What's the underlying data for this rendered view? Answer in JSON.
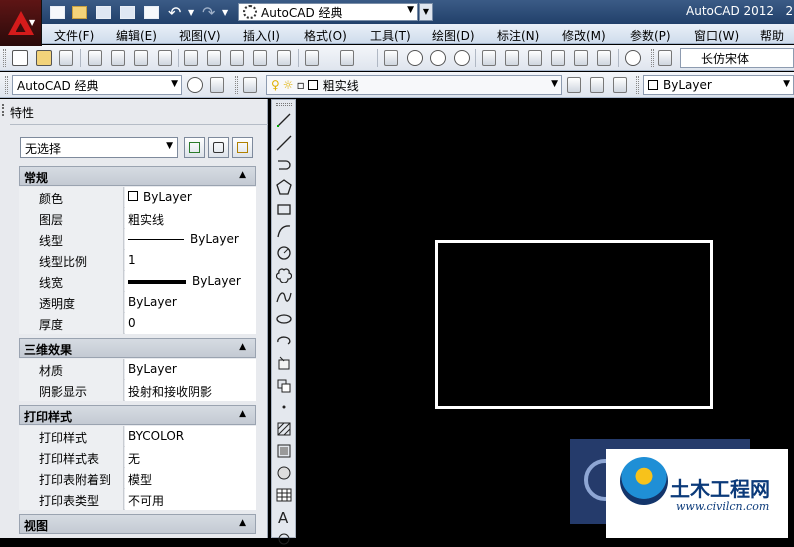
{
  "titlebar": {
    "workspace": "AutoCAD 经典",
    "app_title": "AutoCAD 2012",
    "app_title_tail": "2"
  },
  "menu": [
    "文件(F)",
    "编辑(E)",
    "视图(V)",
    "插入(I)",
    "格式(O)",
    "工具(T)",
    "绘图(D)",
    "标注(N)",
    "修改(M)",
    "参数(P)",
    "窗口(W)",
    "帮助"
  ],
  "toolbar2": {
    "text_style": "长仿宋体",
    "workspace_combo": "AutoCAD 经典",
    "layer_combo": "粗实线",
    "color_combo": "ByLayer"
  },
  "properties": {
    "panel_title": "特性",
    "selection": "无选择",
    "sections": {
      "general": "常规",
      "three_d": "三维效果",
      "plot_style": "打印样式",
      "view": "视图"
    },
    "general": [
      {
        "key": "颜色",
        "value": "ByLayer"
      },
      {
        "key": "图层",
        "value": "粗实线"
      },
      {
        "key": "线型",
        "value": "ByLayer"
      },
      {
        "key": "线型比例",
        "value": "1"
      },
      {
        "key": "线宽",
        "value": "ByLayer"
      },
      {
        "key": "透明度",
        "value": "ByLayer"
      },
      {
        "key": "厚度",
        "value": "0"
      }
    ],
    "three_d": [
      {
        "key": "材质",
        "value": "ByLayer"
      },
      {
        "key": "阴影显示",
        "value": "投射和接收阴影"
      }
    ],
    "plot_style": [
      {
        "key": "打印样式",
        "value": "BYCOLOR"
      },
      {
        "key": "打印样式表",
        "value": "无"
      },
      {
        "key": "打印表附着到",
        "value": "模型"
      },
      {
        "key": "打印表类型",
        "value": "不可用"
      }
    ]
  },
  "watermark": {
    "title": "土木工程网",
    "url": "www.civilcn.com"
  },
  "colors": {
    "title_bar": "#2c4a76",
    "canvas": "#000000",
    "rectangle": "#ffffff"
  }
}
